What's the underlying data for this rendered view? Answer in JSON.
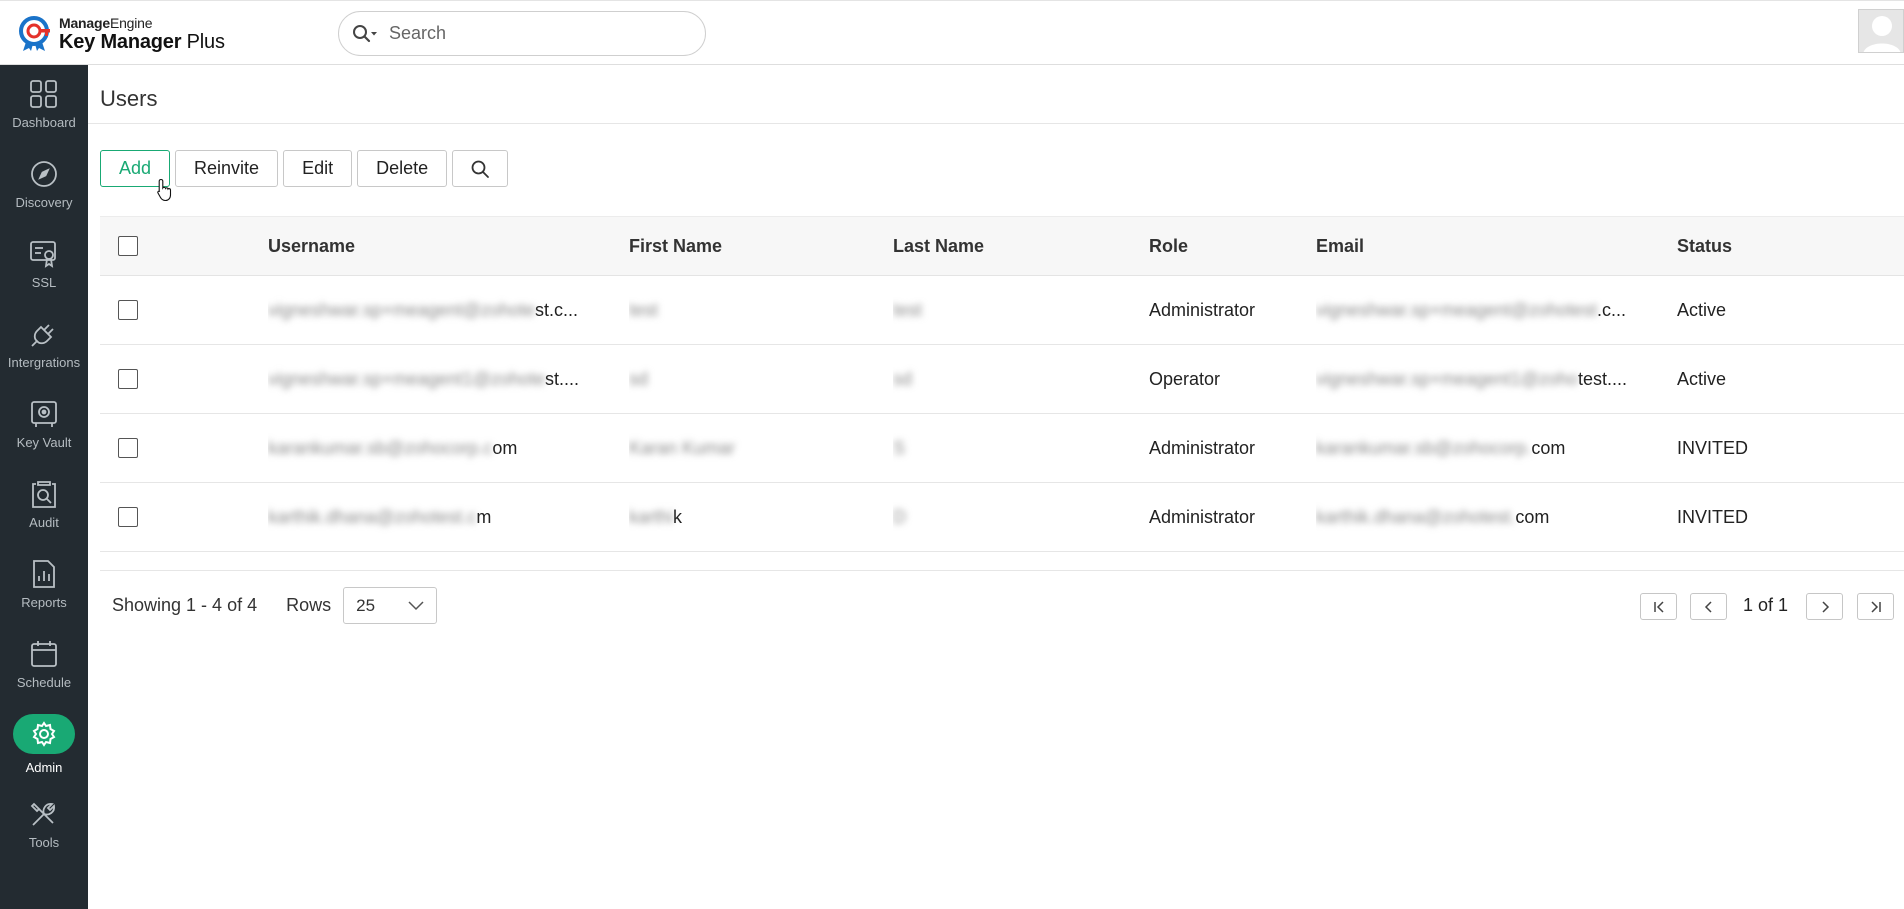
{
  "brand": {
    "top_bold": "Manage",
    "top_normal": "Engine",
    "product_bold": "Key Manager",
    "product_normal": " Plus",
    "accent": "#19a974"
  },
  "search": {
    "placeholder": "Search"
  },
  "sidebar": {
    "items": [
      {
        "label": "Dashboard",
        "icon": "dashboard-icon"
      },
      {
        "label": "Discovery",
        "icon": "compass-icon"
      },
      {
        "label": "SSL",
        "icon": "certificate-icon"
      },
      {
        "label": "Intergrations",
        "icon": "plug-icon"
      },
      {
        "label": "Key Vault",
        "icon": "vault-icon"
      },
      {
        "label": "Audit",
        "icon": "audit-icon"
      },
      {
        "label": "Reports",
        "icon": "reports-icon"
      },
      {
        "label": "Schedule",
        "icon": "calendar-icon"
      },
      {
        "label": "Admin",
        "icon": "gear-icon",
        "active": true
      },
      {
        "label": "Tools",
        "icon": "tools-icon"
      }
    ]
  },
  "page": {
    "title": "Users"
  },
  "toolbar": {
    "add": "Add",
    "reinvite": "Reinvite",
    "edit": "Edit",
    "delete": "Delete"
  },
  "table": {
    "headers": {
      "username": "Username",
      "first": "First Name",
      "last": "Last Name",
      "role": "Role",
      "email": "Email",
      "status": "Status"
    },
    "rows": [
      {
        "user_hidden": "vigneshwar.sp+meagent@zohote",
        "user_visible": "st.c...",
        "first_hidden": "test",
        "first_visible": "",
        "last_hidden": "test",
        "last_visible": "",
        "role": "Administrator",
        "email_hidden": "vigneshwar.sp+meagent@zohotest",
        "email_visible": ".c...",
        "status": "Active"
      },
      {
        "user_hidden": "vigneshwar.sp+meagent1@zohote",
        "user_visible": "st....",
        "first_hidden": "sd",
        "first_visible": "",
        "last_hidden": "sd",
        "last_visible": "",
        "role": "Operator",
        "email_hidden": "vigneshwar.sp+meagent1@zoho",
        "email_visible": "test....",
        "status": "Active"
      },
      {
        "user_hidden": "karankumar.sb@zohocorp.c",
        "user_visible": "om",
        "first_hidden": "Karan Kumar",
        "first_visible": "",
        "last_hidden": "S",
        "last_visible": "",
        "role": "Administrator",
        "email_hidden": "karankumar.sb@zohocorp.",
        "email_visible": "com",
        "status": "INVITED"
      },
      {
        "user_hidden": "karthik.dhana@zohotest.c",
        "user_visible": "m",
        "first_hidden": "karthi",
        "first_visible": "k",
        "last_hidden": "D",
        "last_visible": "",
        "role": "Administrator",
        "email_hidden": "karthik.dhana@zohotest.",
        "email_visible": "com",
        "status": "INVITED"
      }
    ]
  },
  "footer": {
    "showing": "Showing 1 - 4 of 4",
    "rows_label": "Rows",
    "rows_value": "25",
    "page_text": "1 of 1"
  }
}
